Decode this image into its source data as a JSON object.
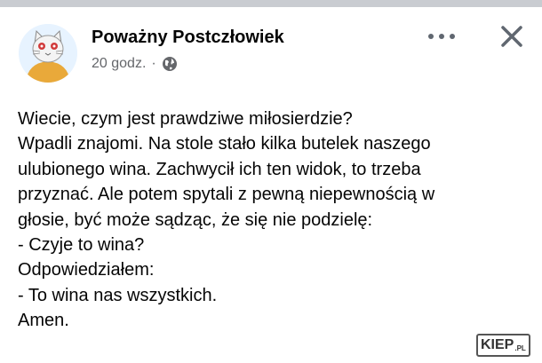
{
  "post": {
    "author": "Poważny Postczłowiek",
    "timestamp": "20 godz.",
    "separator": "·",
    "privacy_icon": "globe-icon",
    "more_icon": "more-options-icon",
    "close_icon": "close-icon",
    "lines": [
      "Wiecie, czym jest prawdziwe miłosierdzie?",
      "Wpadli znajomi. Na stole stało kilka butelek naszego",
      "ulubionego wina. Zachwycił ich ten widok, to trzeba",
      "przyznać. Ale potem spytali z pewną niepewnością w",
      "głosie, być może sądząc, że się nie podzielę:",
      "- Czyje to wina?",
      "Odpowiedziałem:",
      "- To wina nas wszystkich.",
      "Amen."
    ]
  },
  "watermark": {
    "main": "KIEP",
    "suffix": ".PL"
  },
  "colors": {
    "text": "#050505",
    "meta": "#65676b",
    "avatar_bg": "#e7f3ff"
  }
}
